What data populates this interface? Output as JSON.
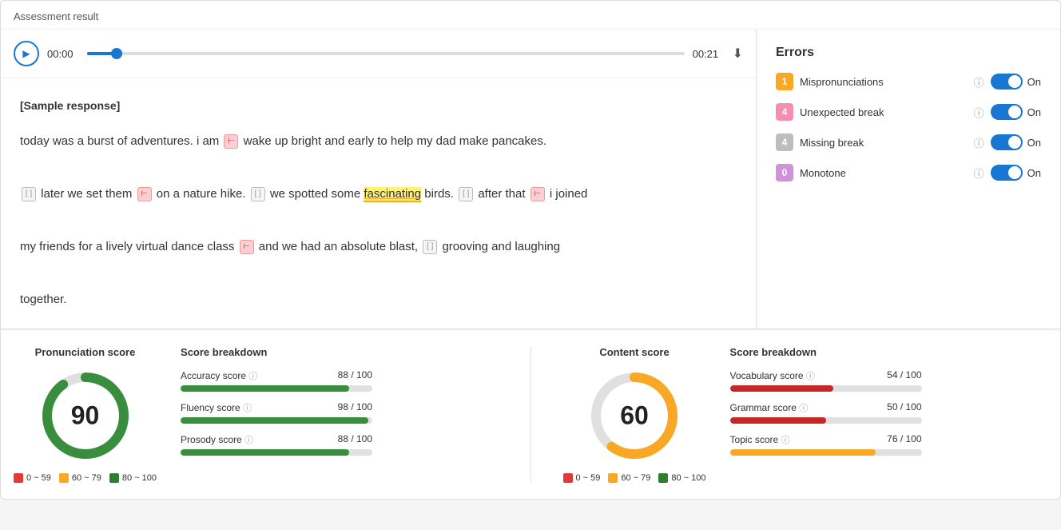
{
  "page": {
    "title": "Assessment result"
  },
  "audio": {
    "time_start": "00:00",
    "time_end": "00:21",
    "play_label": "▶"
  },
  "text_panel": {
    "sample_label": "[Sample response]",
    "text_parts": [
      {
        "type": "text",
        "content": "today was a burst of adventures. i am "
      },
      {
        "type": "unexpected-break",
        "content": "⊢"
      },
      {
        "type": "text",
        "content": " wake up bright and early to help my dad make pancakes."
      },
      {
        "type": "newline"
      },
      {
        "type": "missing-break",
        "content": "[ ]"
      },
      {
        "type": "text",
        "content": " later we set them "
      },
      {
        "type": "unexpected-break",
        "content": "⊢"
      },
      {
        "type": "text",
        "content": " on a nature hike. "
      },
      {
        "type": "missing-break",
        "content": "[ ]"
      },
      {
        "type": "text",
        "content": " we spotted some "
      },
      {
        "type": "highlight",
        "content": "fascinating"
      },
      {
        "type": "text",
        "content": " birds. "
      },
      {
        "type": "missing-break",
        "content": "[ ]"
      },
      {
        "type": "text",
        "content": " after that "
      },
      {
        "type": "unexpected-break",
        "content": "⊢"
      },
      {
        "type": "text",
        "content": " i joined"
      },
      {
        "type": "newline"
      },
      {
        "type": "text",
        "content": "my friends for a lively virtual dance class "
      },
      {
        "type": "unexpected-break",
        "content": "⊢"
      },
      {
        "type": "text",
        "content": " and we had an absolute blast, "
      },
      {
        "type": "missing-break",
        "content": "[ ]"
      },
      {
        "type": "text",
        "content": " grooving and laughing"
      },
      {
        "type": "newline"
      },
      {
        "type": "text",
        "content": "together."
      }
    ]
  },
  "errors": {
    "title": "Errors",
    "items": [
      {
        "badge": "1",
        "badge_class": "badge-yellow",
        "label": "Mispronunciations",
        "toggle": "On"
      },
      {
        "badge": "4",
        "badge_class": "badge-pink",
        "label": "Unexpected break",
        "toggle": "On"
      },
      {
        "badge": "4",
        "badge_class": "badge-gray",
        "label": "Missing break",
        "toggle": "On"
      },
      {
        "badge": "0",
        "badge_class": "badge-purple",
        "label": "Monotone",
        "toggle": "On"
      }
    ]
  },
  "pronunciation_score": {
    "title": "Pronunciation score",
    "value": 90,
    "circle_color": "#388e3c",
    "circle_bg": "#bdbdbd",
    "radius": 48,
    "circumference": 301.6,
    "fill_pct": 0.9
  },
  "pronunciation_breakdown": {
    "title": "Score breakdown",
    "items": [
      {
        "label": "Accuracy score",
        "value": "88 / 100",
        "pct": 88,
        "bar_class": "bar-green"
      },
      {
        "label": "Fluency score",
        "value": "98 / 100",
        "pct": 98,
        "bar_class": "bar-green"
      },
      {
        "label": "Prosody score",
        "value": "88 / 100",
        "pct": 88,
        "bar_class": "bar-green"
      }
    ]
  },
  "content_score": {
    "title": "Content score",
    "value": 60,
    "circle_color": "#f9a825",
    "circle_bg": "#bdbdbd",
    "radius": 48,
    "circumference": 301.6,
    "fill_pct": 0.6
  },
  "content_breakdown": {
    "title": "Score breakdown",
    "items": [
      {
        "label": "Vocabulary score",
        "value": "54 / 100",
        "pct": 54,
        "bar_class": "bar-red"
      },
      {
        "label": "Grammar score",
        "value": "50 / 100",
        "pct": 50,
        "bar_class": "bar-red"
      },
      {
        "label": "Topic score",
        "value": "76 / 100",
        "pct": 76,
        "bar_class": "bar-yellow"
      }
    ]
  },
  "legend": {
    "items": [
      {
        "label": "0 ~ 59",
        "dot_class": "dot-red"
      },
      {
        "label": "60 ~ 79",
        "dot_class": "dot-yellow"
      },
      {
        "label": "80 ~ 100",
        "dot_class": "dot-green"
      }
    ]
  }
}
